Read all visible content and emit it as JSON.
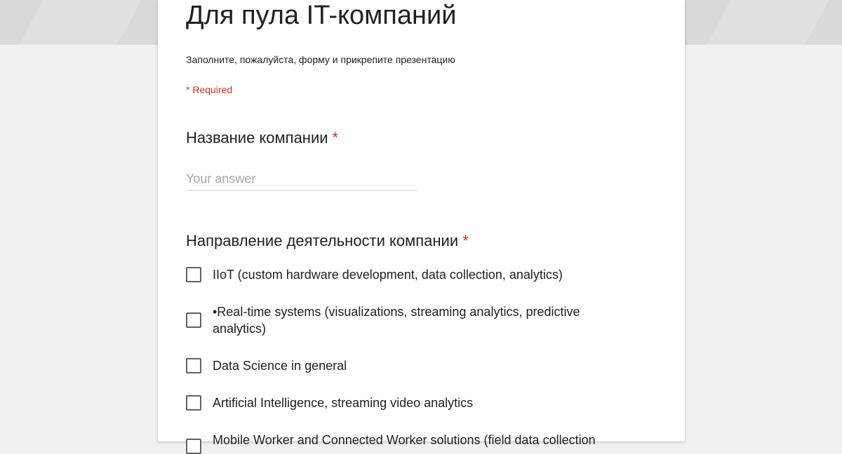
{
  "form": {
    "title": "Для пула IT-компаний",
    "description": "Заполните, пожалуйста, форму и прикрепите презентацию",
    "required_note": "* Required"
  },
  "questions": {
    "company_name": {
      "title": "Название компании",
      "required_mark": "*",
      "placeholder": "Your answer"
    },
    "activity": {
      "title": "Направление деятельности компании",
      "required_mark": "*",
      "options": [
        "IIoT (custom hardware development, data collection, analytics)",
        "•Real-time systems (visualizations, streaming analytics, predictive analytics)",
        "Data Science in general",
        "Artificial Intelligence, streaming video analytics",
        "Mobile Worker and Connected Worker solutions (field data collection"
      ]
    }
  },
  "colors": {
    "required": "#d93025",
    "text": "#202124",
    "header_bg": "#d9d9d9",
    "page_bg": "#f1f1f1"
  }
}
